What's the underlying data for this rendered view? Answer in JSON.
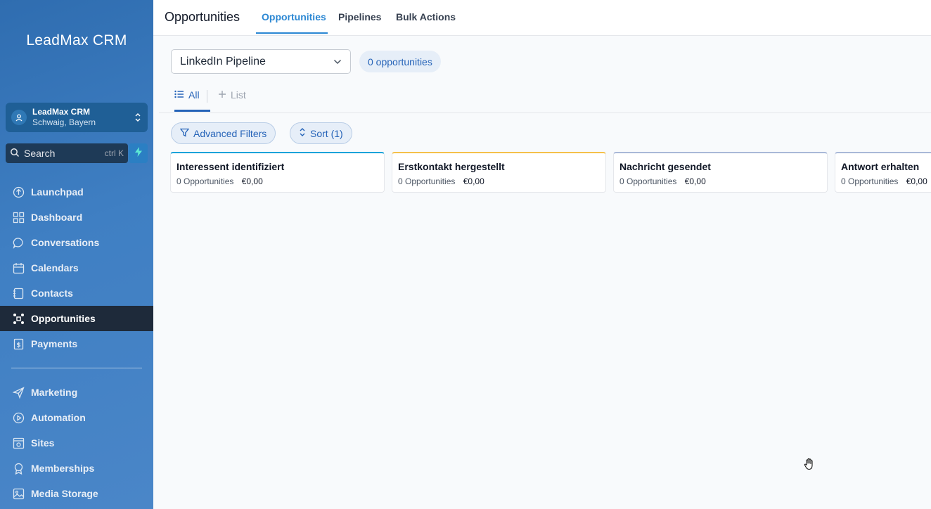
{
  "sidebar": {
    "brand": "LeadMax CRM",
    "account": {
      "name": "LeadMax CRM",
      "location": "Schwaig, Bayern"
    },
    "search": {
      "label": "Search",
      "shortcut": "ctrl K"
    },
    "nav_primary": [
      {
        "label": "Launchpad",
        "icon": "launchpad-icon",
        "active": false
      },
      {
        "label": "Dashboard",
        "icon": "dashboard-icon",
        "active": false
      },
      {
        "label": "Conversations",
        "icon": "chat-icon",
        "active": false
      },
      {
        "label": "Calendars",
        "icon": "calendar-icon",
        "active": false
      },
      {
        "label": "Contacts",
        "icon": "contacts-icon",
        "active": false
      },
      {
        "label": "Opportunities",
        "icon": "opportunities-icon",
        "active": true
      },
      {
        "label": "Payments",
        "icon": "payments-icon",
        "active": false
      }
    ],
    "nav_secondary": [
      {
        "label": "Marketing",
        "icon": "send-icon"
      },
      {
        "label": "Automation",
        "icon": "automation-icon"
      },
      {
        "label": "Sites",
        "icon": "sites-icon"
      },
      {
        "label": "Memberships",
        "icon": "badge-icon"
      },
      {
        "label": "Media Storage",
        "icon": "image-icon"
      }
    ]
  },
  "header": {
    "title": "Opportunities",
    "tabs": [
      {
        "label": "Opportunities",
        "active": true
      },
      {
        "label": "Pipelines",
        "active": false
      },
      {
        "label": "Bulk Actions",
        "active": false
      }
    ]
  },
  "toolbar": {
    "pipeline": "LinkedIn Pipeline",
    "count_badge": "0 opportunities"
  },
  "views": {
    "all": "All",
    "add_list": "List"
  },
  "filters": {
    "advanced": "Advanced Filters",
    "sort": "Sort (1)"
  },
  "stages": [
    {
      "name": "Interessent identifiziert",
      "count": "0 Opportunities",
      "amount": "€0,00",
      "color": "#1aa3d9"
    },
    {
      "name": "Erstkontakt hergestellt",
      "count": "0 Opportunities",
      "amount": "€0,00",
      "color": "#f5c04a"
    },
    {
      "name": "Nachricht gesendet",
      "count": "0 Opportunities",
      "amount": "€0,00",
      "color": "#a9b8d8"
    },
    {
      "name": "Antwort erhalten",
      "count": "0 Opportunities",
      "amount": "€0,00",
      "color": "#a9b8d8"
    }
  ],
  "colors": {
    "accent": "#2563b8",
    "tab_active": "#2b87d3",
    "sidebar_active": "#1e2a3a"
  }
}
